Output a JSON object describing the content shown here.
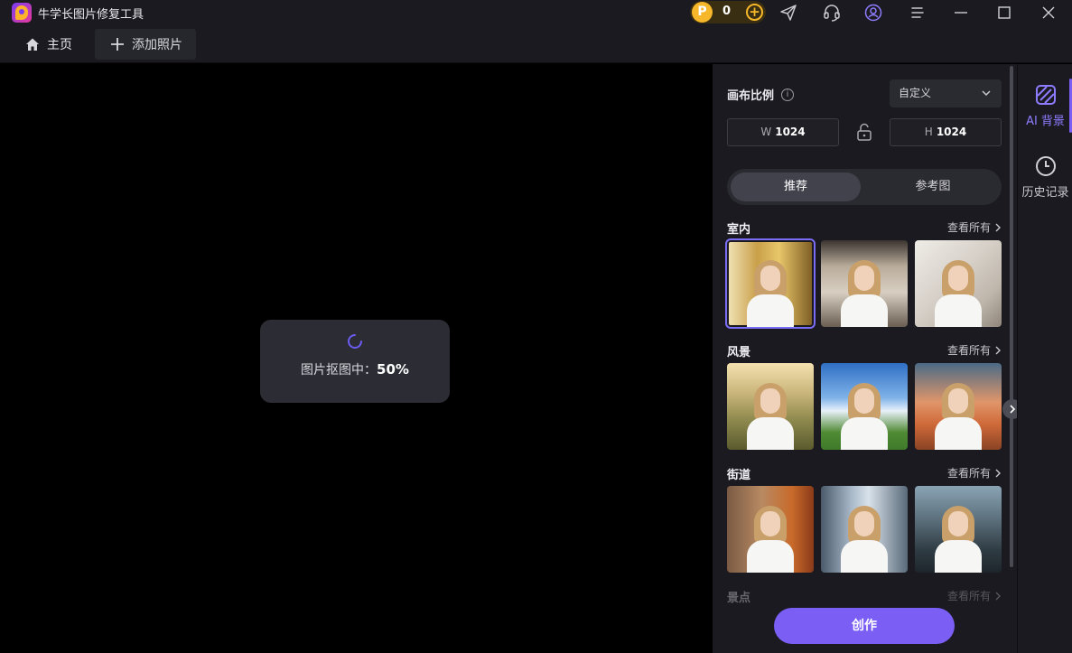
{
  "window": {
    "title": "牛学长图片修复工具",
    "coins": "0",
    "icons": [
      "send-icon",
      "support-headset-icon",
      "account-icon",
      "menu-icon",
      "minimize-icon",
      "maximize-icon",
      "close-icon"
    ]
  },
  "menubar": {
    "home_label": "主页",
    "add_label": "添加照片"
  },
  "canvas": {
    "progress_label": "图片抠图中：",
    "progress_value": "50%",
    "progress_fraction": 0.5
  },
  "panel": {
    "ratio_label": "画布比例",
    "ratio_value": "自定义",
    "width_label": "W",
    "width_value": "1024",
    "height_label": "H",
    "height_value": "1024",
    "tabs": [
      {
        "label": "推荐",
        "active": true
      },
      {
        "label": "参考图",
        "active": false
      }
    ],
    "view_all_label": "查看所有",
    "sections": [
      {
        "title": "室内",
        "thumbs": [
          "golden curtains interior",
          "luxury room interior",
          "marble wall interior"
        ]
      },
      {
        "title": "风景",
        "thumbs": [
          "wheat field sunset",
          "blue sky meadow",
          "desert sunset"
        ]
      },
      {
        "title": "街道",
        "thumbs": [
          "autumn street",
          "city skyscrapers",
          "mountain town street"
        ]
      },
      {
        "title": "景点",
        "thumbs": []
      }
    ],
    "create_label": "创作"
  },
  "rail": {
    "items": [
      {
        "label": "AI 背景",
        "icon": "ai-background-icon",
        "active": true
      },
      {
        "label": "历史记录",
        "icon": "history-clock-icon",
        "active": false
      }
    ]
  },
  "colors": {
    "accent": "#7b5ff5",
    "panel_bg": "#1a1a20",
    "canvas_bg": "#000000",
    "coin": "#f6b72a"
  }
}
